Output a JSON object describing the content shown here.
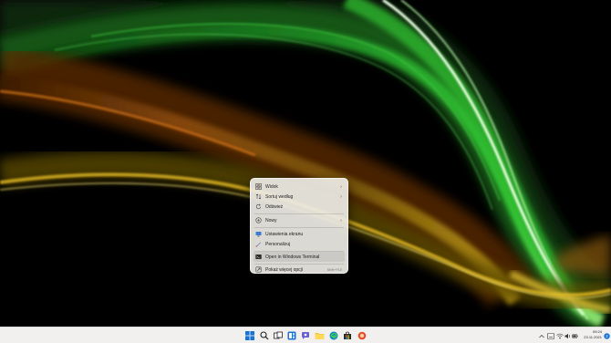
{
  "context_menu": {
    "items": [
      {
        "label": "Widok",
        "icon": "view-icon",
        "submenu": true
      },
      {
        "label": "Sortuj według",
        "icon": "sort-icon",
        "submenu": true
      },
      {
        "label": "Odśwież",
        "icon": "refresh-icon",
        "submenu": false
      },
      {
        "label": "Nowy",
        "icon": "new-icon",
        "submenu": true
      },
      {
        "label": "Ustawienia ekranu",
        "icon": "display-settings-icon",
        "submenu": false
      },
      {
        "label": "Personalizuj",
        "icon": "personalize-icon",
        "submenu": false
      },
      {
        "label": "Open in Windows Terminal",
        "icon": "terminal-icon",
        "submenu": false
      },
      {
        "label": "Pokaż więcej opcji",
        "icon": "more-options-icon",
        "shortcut": "Shift+F10"
      }
    ]
  },
  "taskbar": {
    "apps": [
      "start-icon",
      "search-icon",
      "task-view-icon",
      "widgets-icon",
      "chat-icon",
      "file-explorer-icon",
      "edge-icon",
      "store-icon",
      "other-app-icon"
    ],
    "clock": {
      "time": "09:24",
      "date": "23.11.2021"
    }
  },
  "colors": {
    "accent": "#0067c0",
    "taskbar_bg": "#f1f0ee",
    "menu_bg": "#eeece6"
  }
}
